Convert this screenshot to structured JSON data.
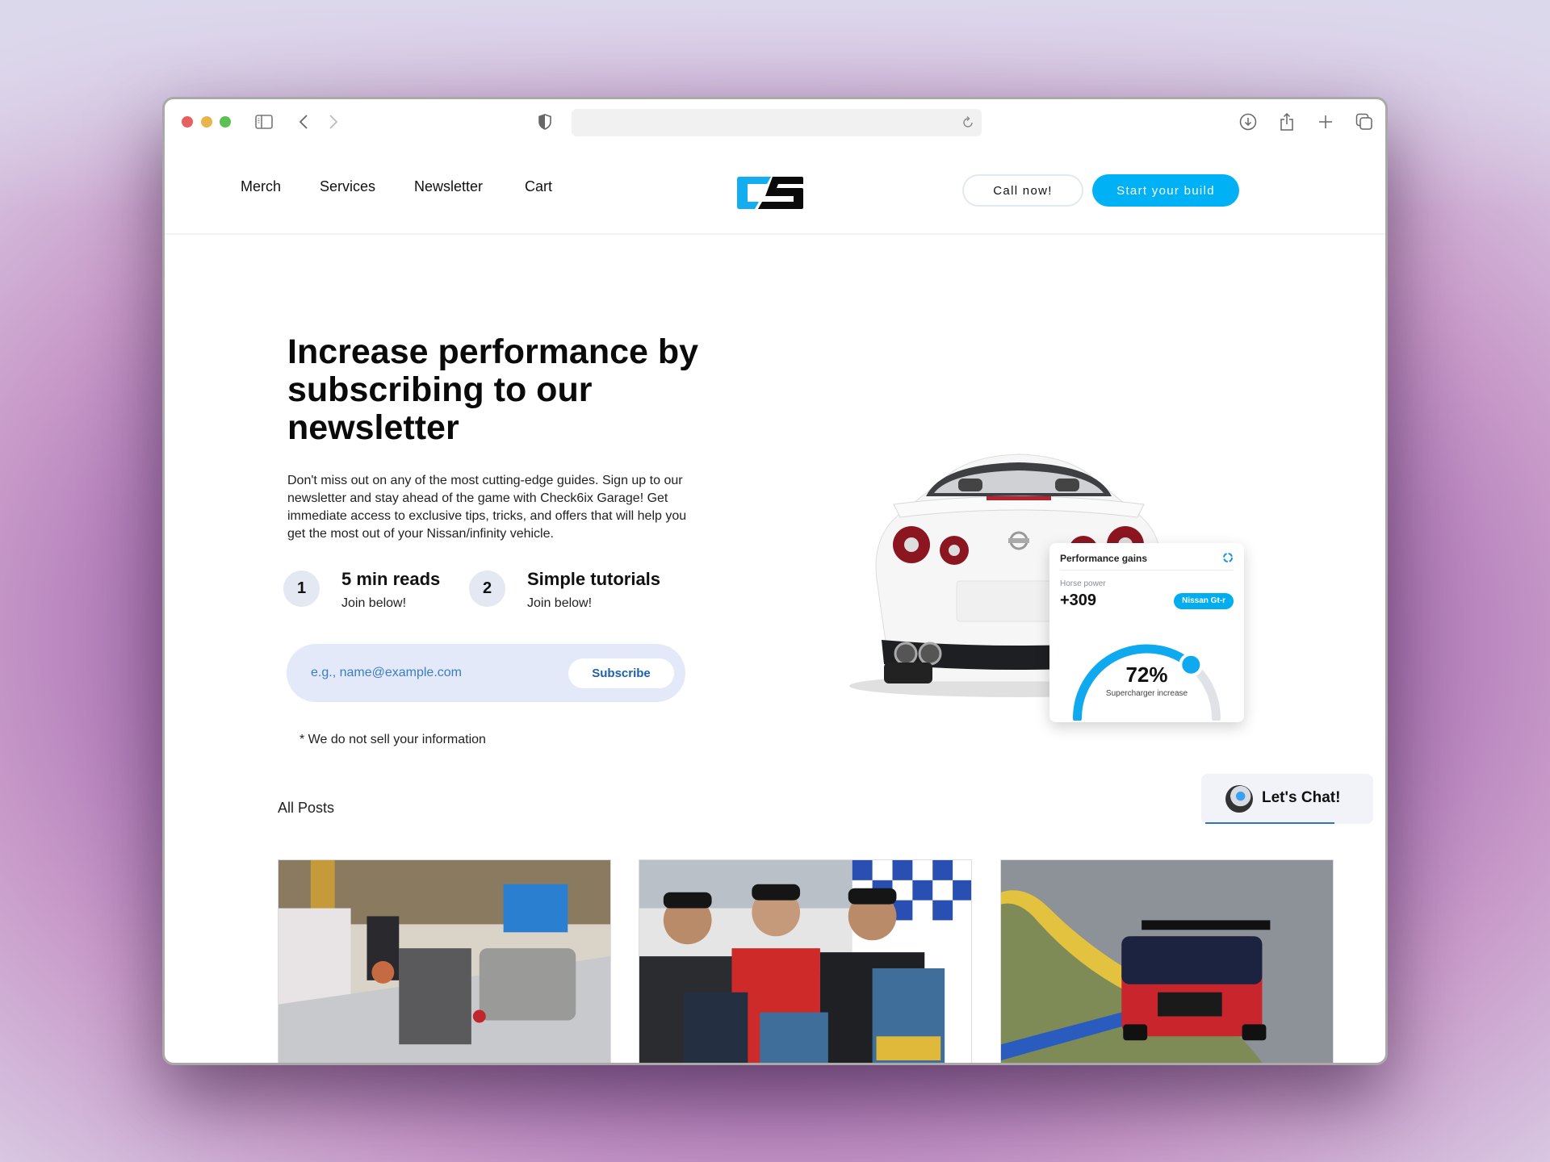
{
  "browser": {
    "url": "",
    "icons": [
      "sidebar-icon",
      "back-icon",
      "forward-icon",
      "shield-icon",
      "reload-icon",
      "download-icon",
      "share-icon",
      "new-tab-icon",
      "tabs-overview-icon"
    ]
  },
  "header": {
    "nav": [
      "Merch",
      "Services",
      "Newsletter",
      "Cart"
    ],
    "logo_alt": "C6 logo",
    "call_label": "Call now!",
    "build_label": "Start your build"
  },
  "hero": {
    "headline": "Increase performance by subscribing to our newsletter",
    "intro": "Don't miss out on any of the most cutting-edge guides. Sign up to our newsletter and stay ahead of the game with Check6ix Garage! Get immediate access to exclusive tips, tricks, and offers that will help you get the most out of your Nissan/infinity vehicle.",
    "features": [
      {
        "num": "1",
        "title": "5 min reads",
        "sub": "Join below!"
      },
      {
        "num": "2",
        "title": "Simple tutorials",
        "sub": "Join below!"
      }
    ],
    "email_placeholder": "e.g., name@example.com",
    "email_value": "",
    "subscribe_label": "Subscribe",
    "disclaimer": "* We do not sell your information"
  },
  "perf_card": {
    "title": "Performance gains",
    "hp_label": "Horse power",
    "hp_value": "+309",
    "badge": "Nissan Gt-r",
    "gauge_fraction": 0.72,
    "percent": "72%",
    "percent_label": "Supercharger increase"
  },
  "chat": {
    "label": "Let's Chat!"
  },
  "posts": {
    "heading": "All Posts",
    "items": [
      {
        "image": "garage-engine-work"
      },
      {
        "image": "podium-three-drivers"
      },
      {
        "image": "gtr-on-race-track"
      }
    ]
  },
  "colors": {
    "accent": "#00b2f5",
    "subscribe_bg": "#e3e9f9",
    "subscribe_text": "#1d5fb0",
    "gauge_track": "#dfe3e8"
  }
}
